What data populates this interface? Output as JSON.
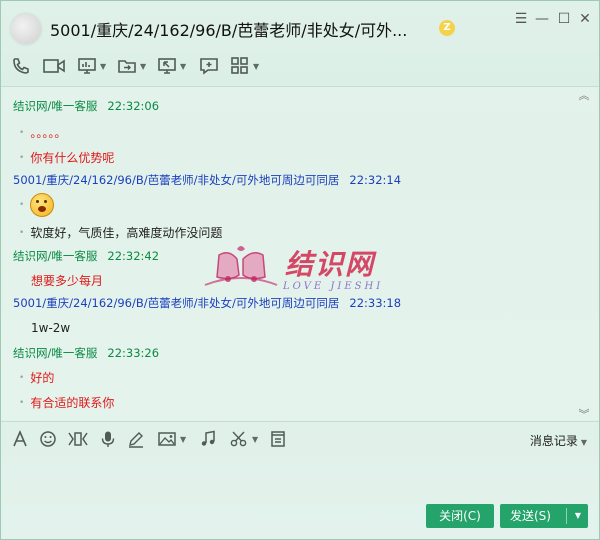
{
  "window": {
    "title": "5001/重庆/24/162/96/B/芭蕾老师/非处女/可外...",
    "badge": "Z"
  },
  "chat": {
    "messages": [
      {
        "sender": "结识网/唯一客服",
        "time": "22:32:06",
        "lines": [
          "。。。。。",
          "你有什么优势呢"
        ]
      },
      {
        "sender": "5001/重庆/24/162/96/B/芭蕾老师/非处女/可外地可周边可同居",
        "time": "22:32:14",
        "lines": [
          "软度好，气质佳，高难度动作没问题"
        ],
        "emoji": "surprised-face"
      },
      {
        "sender": "结识网/唯一客服",
        "time": "22:32:42",
        "lines": [
          "想要多少每月"
        ]
      },
      {
        "sender": "5001/重庆/24/162/96/B/芭蕾老师/非处女/可外地可周边可同居",
        "time": "22:33:18",
        "lines": [
          "1w-2w"
        ]
      },
      {
        "sender": "结识网/唯一客服",
        "time": "22:33:26",
        "lines": [
          "好的",
          "有合适的联系你"
        ]
      }
    ]
  },
  "watermark": {
    "text": "结识网",
    "sub": "LOVE JIESHI"
  },
  "input": {
    "history_label": "消息记录",
    "close_label": "关闭(C)",
    "send_label": "发送(S)"
  },
  "colors": {
    "agent": "#0a8a43",
    "user": "#1b3fbd",
    "red_text": "#e01818",
    "button": "#24a36b"
  }
}
